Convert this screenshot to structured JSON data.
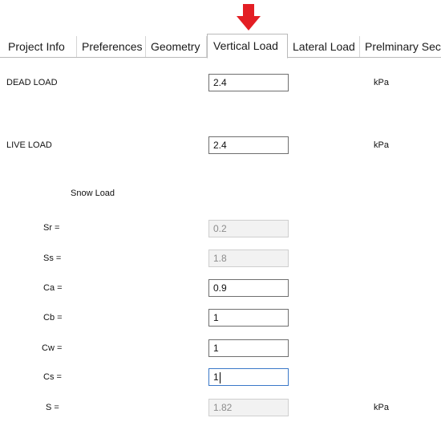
{
  "tabs": [
    {
      "label": "Project Info"
    },
    {
      "label": "Preferences"
    },
    {
      "label": "Geometry"
    },
    {
      "label": "Vertical Load",
      "active": true
    },
    {
      "label": "Lateral Load"
    },
    {
      "label": "Prelminary Sec"
    }
  ],
  "arrow_color": "#e31e24",
  "dead_load": {
    "label": "DEAD LOAD",
    "value": "2.4",
    "unit": "kPa"
  },
  "live_load": {
    "label": "LIVE LOAD",
    "value": "2.4",
    "unit": "kPa"
  },
  "snow": {
    "heading": "Snow Load",
    "sr": {
      "label": "Sr =",
      "value": "0.2"
    },
    "ss": {
      "label": "Ss =",
      "value": "1.8"
    },
    "ca": {
      "label": "Ca =",
      "value": "0.9"
    },
    "cb": {
      "label": "Cb =",
      "value": "1"
    },
    "cw": {
      "label": "Cw =",
      "value": "1"
    },
    "cs": {
      "label": "Cs =",
      "value": "1"
    },
    "s": {
      "label": "S =",
      "value": "1.82",
      "unit": "kPa"
    }
  }
}
